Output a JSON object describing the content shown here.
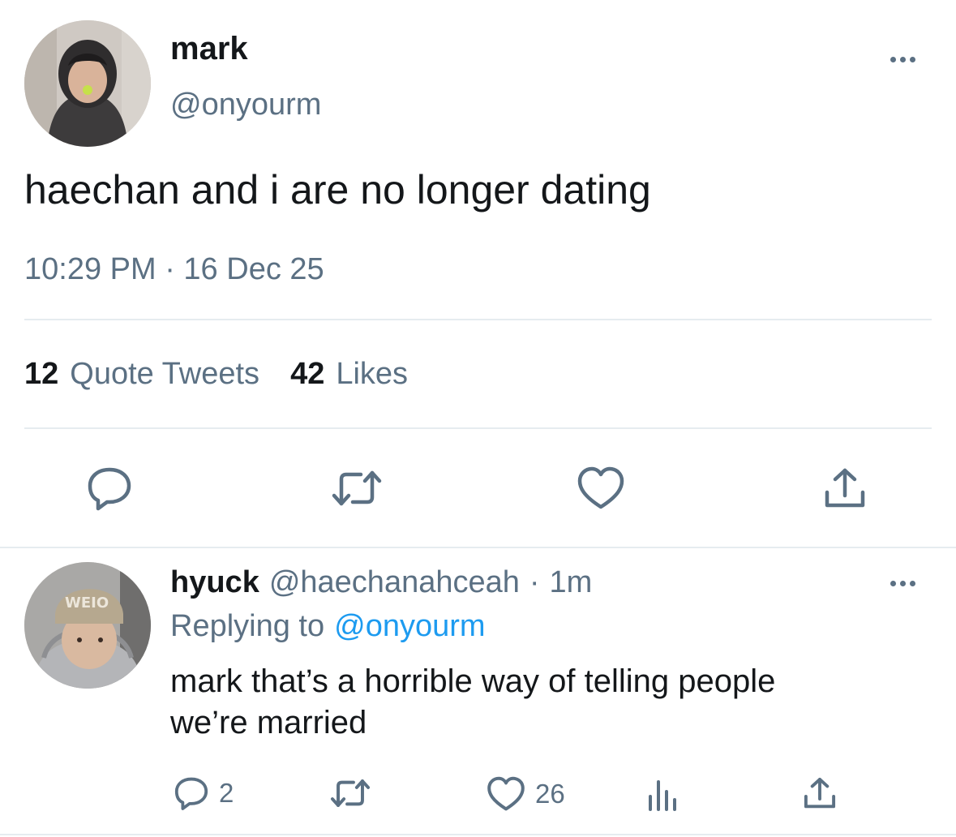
{
  "main_tweet": {
    "display_name": "mark",
    "handle": "@onyourm",
    "text": "haechan and i are no longer dating",
    "timestamp": "10:29 PM · 16 Dec 25",
    "stats": {
      "quote_tweets_count": "12",
      "quote_tweets_label": "Quote Tweets",
      "likes_count": "42",
      "likes_label": "Likes"
    },
    "actions": [
      "reply-icon",
      "retweet-icon",
      "like-icon",
      "share-icon"
    ]
  },
  "reply": {
    "display_name": "hyuck",
    "handle": "@haechanahceah",
    "separator": "·",
    "time": "1m",
    "replying_to_label": "Replying to",
    "replying_to_handle": "@onyourm",
    "text_line1": "mark that’s a horrible way of telling people",
    "text_line2": "we’re married",
    "counts": {
      "replies": "2",
      "likes": "26"
    },
    "actions": [
      "reply-icon",
      "retweet-icon",
      "like-icon",
      "analytics-icon",
      "share-icon"
    ]
  },
  "colors": {
    "text": "#14171a",
    "muted": "#5b7083",
    "link": "#1d9bf0",
    "divider": "#e6ecf0"
  }
}
